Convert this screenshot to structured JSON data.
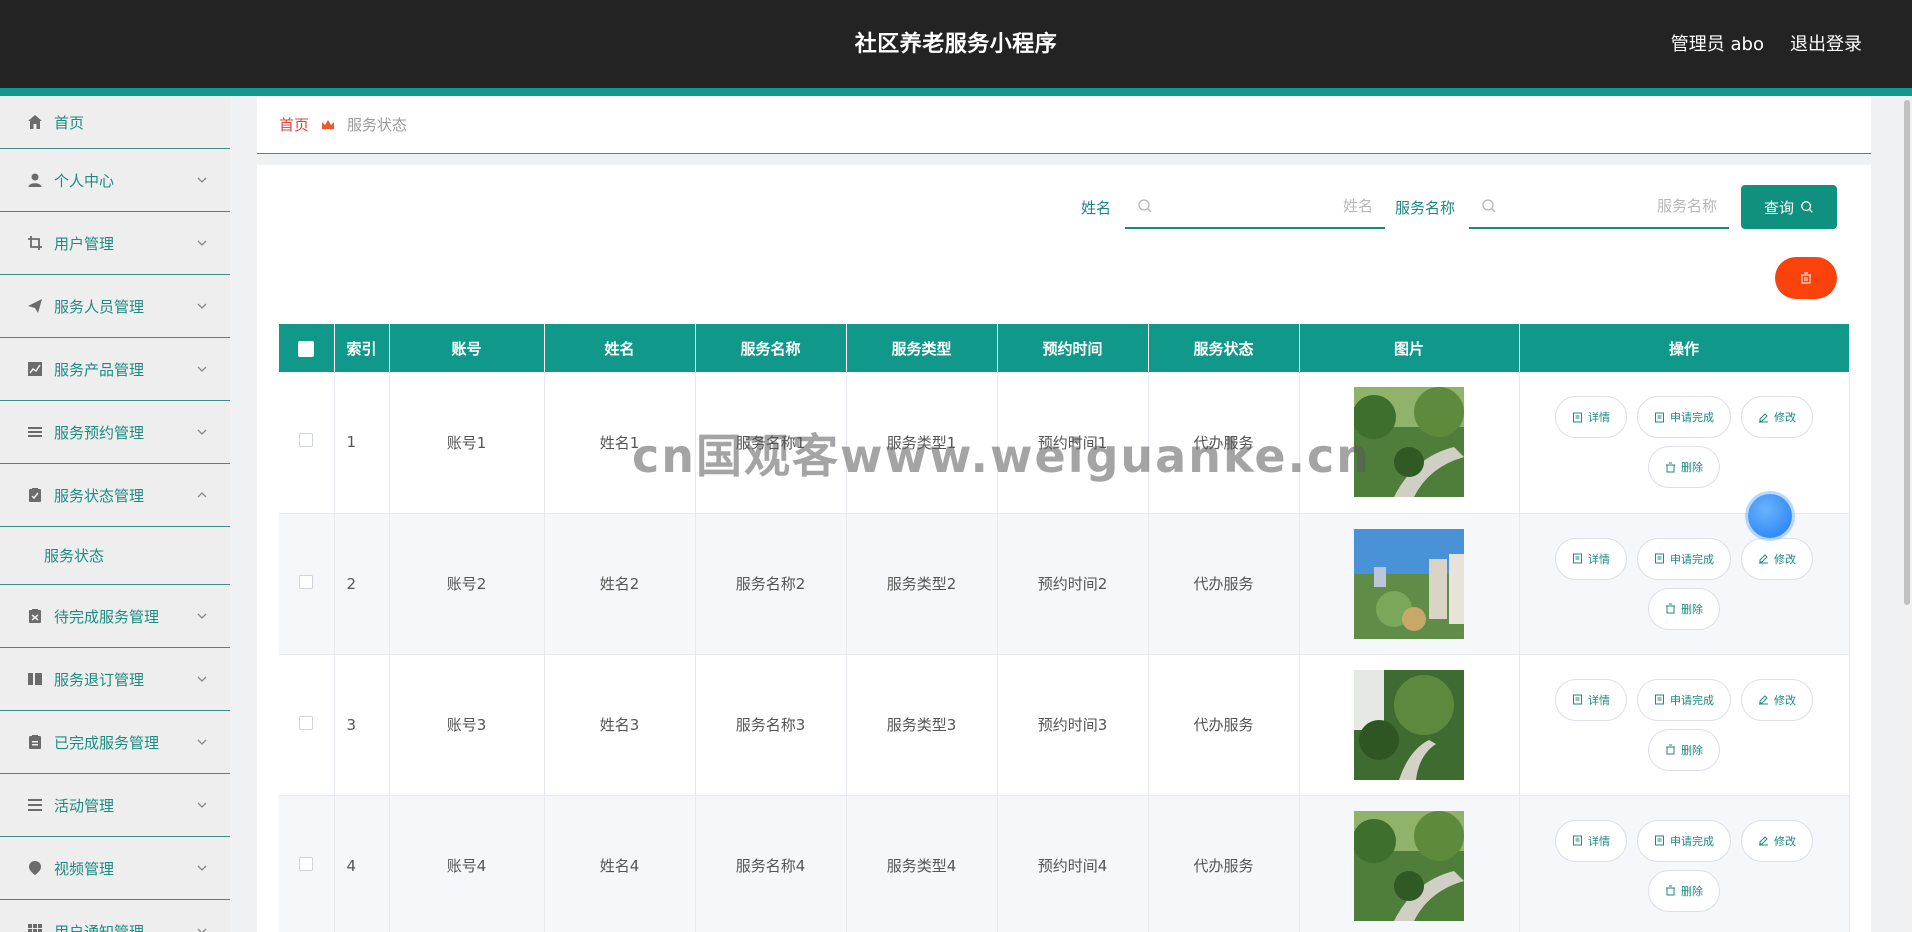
{
  "header": {
    "title": "社区养老服务小程序",
    "admin_label": "管理员 abo",
    "logout_label": "退出登录"
  },
  "sidebar": {
    "items": [
      {
        "label": "首页",
        "icon": "home-icon",
        "expanded": false
      },
      {
        "label": "个人中心",
        "icon": "user-icon",
        "expanded": false
      },
      {
        "label": "用户管理",
        "icon": "crop-icon",
        "expanded": false
      },
      {
        "label": "服务人员管理",
        "icon": "send-icon",
        "expanded": false
      },
      {
        "label": "服务产品管理",
        "icon": "chart-icon",
        "expanded": false
      },
      {
        "label": "服务预约管理",
        "icon": "list-icon",
        "expanded": false
      },
      {
        "label": "服务状态管理",
        "icon": "clipboard-check-icon",
        "expanded": true,
        "children": [
          "服务状态"
        ]
      },
      {
        "label": "待完成服务管理",
        "icon": "clipboard-todo-icon",
        "expanded": false
      },
      {
        "label": "服务退订管理",
        "icon": "book-icon",
        "expanded": false
      },
      {
        "label": "已完成服务管理",
        "icon": "clipboard-done-icon",
        "expanded": false
      },
      {
        "label": "活动管理",
        "icon": "menu-icon",
        "expanded": false
      },
      {
        "label": "视频管理",
        "icon": "location-icon",
        "expanded": false
      },
      {
        "label": "用户通知管理",
        "icon": "grid-icon",
        "expanded": false
      }
    ]
  },
  "breadcrumb": {
    "home": "首页",
    "current": "服务状态"
  },
  "search": {
    "name_label": "姓名",
    "name_placeholder": "姓名",
    "name_value": "",
    "service_label": "服务名称",
    "service_placeholder": "服务名称",
    "service_value": "",
    "query_label": "查询"
  },
  "table": {
    "headers": [
      "",
      "索引",
      "账号",
      "姓名",
      "服务名称",
      "服务类型",
      "预约时间",
      "服务状态",
      "图片",
      "操作"
    ],
    "rows": [
      {
        "index": "1",
        "account": "账号1",
        "name": "姓名1",
        "service_name": "服务名称1",
        "service_type": "服务类型1",
        "time": "预约时间1",
        "status": "代办服务",
        "image": "park-path"
      },
      {
        "index": "2",
        "account": "账号2",
        "name": "姓名2",
        "service_name": "服务名称2",
        "service_type": "服务类型2",
        "time": "预约时间2",
        "status": "代办服务",
        "image": "residential-aerial"
      },
      {
        "index": "3",
        "account": "账号3",
        "name": "姓名3",
        "service_name": "服务名称3",
        "service_type": "服务类型3",
        "time": "预约时间3",
        "status": "代办服务",
        "image": "garden-walkway"
      },
      {
        "index": "4",
        "account": "账号4",
        "name": "姓名4",
        "service_name": "服务名称4",
        "service_type": "服务类型4",
        "time": "预约时间4",
        "status": "代办服务",
        "image": "park-path"
      }
    ],
    "actions": {
      "detail": "详情",
      "apply_complete": "申请完成",
      "edit": "修改",
      "delete": "删除"
    }
  },
  "watermark": "cn国观客www.weiguanke.cn",
  "colors": {
    "header_bg": "#232323",
    "accent": "#10998a",
    "danger": "#f9420c",
    "breadcrumb_home": "#e4413a"
  }
}
